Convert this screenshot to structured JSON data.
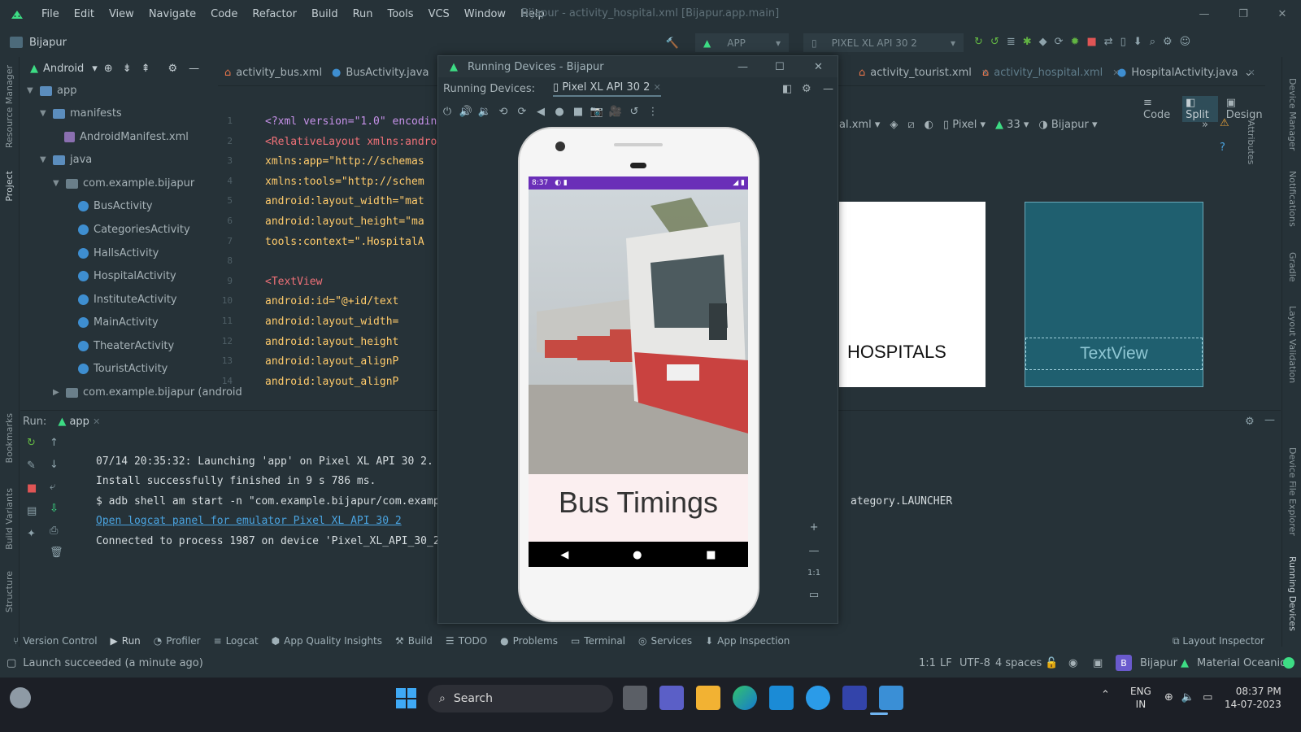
{
  "window_title": "Bijapur - activity_hospital.xml [Bijapur.app.main]",
  "menu": [
    "File",
    "Edit",
    "View",
    "Navigate",
    "Code",
    "Refactor",
    "Build",
    "Run",
    "Tools",
    "VCS",
    "Window",
    "Help"
  ],
  "toolbar": {
    "project_name": "Bijapur",
    "run_config": "APP",
    "device": "PIXEL XL API 30 2"
  },
  "project_panel": {
    "view_mode": "Android",
    "tree": [
      {
        "label": "app",
        "type": "folder"
      },
      {
        "label": "manifests",
        "type": "folder"
      },
      {
        "label": "AndroidManifest.xml",
        "type": "manifest"
      },
      {
        "label": "java",
        "type": "folder"
      },
      {
        "label": "com.example.bijapur",
        "type": "package"
      },
      {
        "label": "BusActivity",
        "type": "class"
      },
      {
        "label": "CategoriesActivity",
        "type": "class"
      },
      {
        "label": "HallsActivity",
        "type": "class"
      },
      {
        "label": "HospitalActivity",
        "type": "class"
      },
      {
        "label": "InstituteActivity",
        "type": "class"
      },
      {
        "label": "MainActivity",
        "type": "class"
      },
      {
        "label": "TheaterActivity",
        "type": "class"
      },
      {
        "label": "TouristActivity",
        "type": "class"
      },
      {
        "label": "com.example.bijapur (android",
        "type": "package"
      }
    ]
  },
  "left_strip_labels": [
    "Resource Manager",
    "Project",
    "Bookmarks",
    "Build Variants",
    "Structure"
  ],
  "right_strip_labels": [
    "Device Manager",
    "Notifications",
    "Gradle",
    "Layout Validation",
    "Device File Explorer",
    "Running Devices"
  ],
  "attributes_label": "Attributes",
  "editor_tabs": [
    {
      "label": "activity_bus.xml",
      "kind": "xml"
    },
    {
      "label": "BusActivity.java",
      "kind": "java"
    },
    {
      "label": "activity_tourist.xml",
      "kind": "xml"
    },
    {
      "label": "activity_hospital.xml",
      "kind": "xml",
      "active": true
    },
    {
      "label": "HospitalActivity.java",
      "kind": "java"
    }
  ],
  "code_lines": [
    {
      "n": "1",
      "text": "<?xml version=\"1.0\" encoding="
    },
    {
      "n": "2",
      "text": "<RelativeLayout xmlns:android"
    },
    {
      "n": "3",
      "text": "    xmlns:app=\"http://schemas"
    },
    {
      "n": "4",
      "text": "    xmlns:tools=\"http://schem"
    },
    {
      "n": "5",
      "text": "    android:layout_width=\"mat"
    },
    {
      "n": "6",
      "text": "    android:layout_height=\"ma"
    },
    {
      "n": "7",
      "text": "    tools:context=\".HospitalA"
    },
    {
      "n": "8",
      "text": ""
    },
    {
      "n": "9",
      "text": "    <TextView"
    },
    {
      "n": "10",
      "text": "        android:id=\"@+id/text"
    },
    {
      "n": "11",
      "text": "        android:layout_width="
    },
    {
      "n": "12",
      "text": "        android:layout_height"
    },
    {
      "n": "13",
      "text": "        android:layout_alignP"
    },
    {
      "n": "14",
      "text": "        android:layout_alignP"
    }
  ],
  "design": {
    "modes": [
      "Code",
      "Split",
      "Design"
    ],
    "active_mode": "Split",
    "file_dropdown": "al.xml",
    "device": "Pixel",
    "api": "33",
    "theme": "Bijapur",
    "preview_text": "HOSPITALS",
    "blueprint_text": "TextView"
  },
  "running_devices": {
    "title": "Running Devices - Bijapur",
    "label": "Running Devices:",
    "tab": "Pixel XL API 30 2",
    "zoom_label": "1:1",
    "phone": {
      "time": "8:37",
      "screen_title": "Bus Timings"
    }
  },
  "run_panel": {
    "label": "Run:",
    "config": "app",
    "lines": [
      "07/14 20:35:32: Launching 'app' on Pixel XL API 30 2.",
      "Install successfully finished in 9 s 786 ms.",
      "$ adb shell am start -n \"com.example.bijapur/com.example.bija",
      "Connected to process 1987 on device 'Pixel_XL_API_30_2 [emula"
    ],
    "link": "Open logcat panel for emulator Pixel XL API 30 2",
    "tail": "ategory.LAUNCHER"
  },
  "tool_tabs": [
    "Version Control",
    "Run",
    "Profiler",
    "Logcat",
    "App Quality Insights",
    "Build",
    "TODO",
    "Problems",
    "Terminal",
    "Services",
    "App Inspection"
  ],
  "layout_inspector": "Layout Inspector",
  "status": {
    "message": "Launch succeeded (a minute ago)",
    "position": "1:1",
    "line_sep": "LF",
    "encoding": "UTF-8",
    "indent": "4 spaces",
    "project_badge": "B",
    "project": "Bijapur",
    "theme": "Material Oceanic"
  },
  "taskbar": {
    "search_placeholder": "Search",
    "lang": "ENG",
    "region": "IN",
    "time": "08:37 PM",
    "date": "14-07-2023"
  }
}
